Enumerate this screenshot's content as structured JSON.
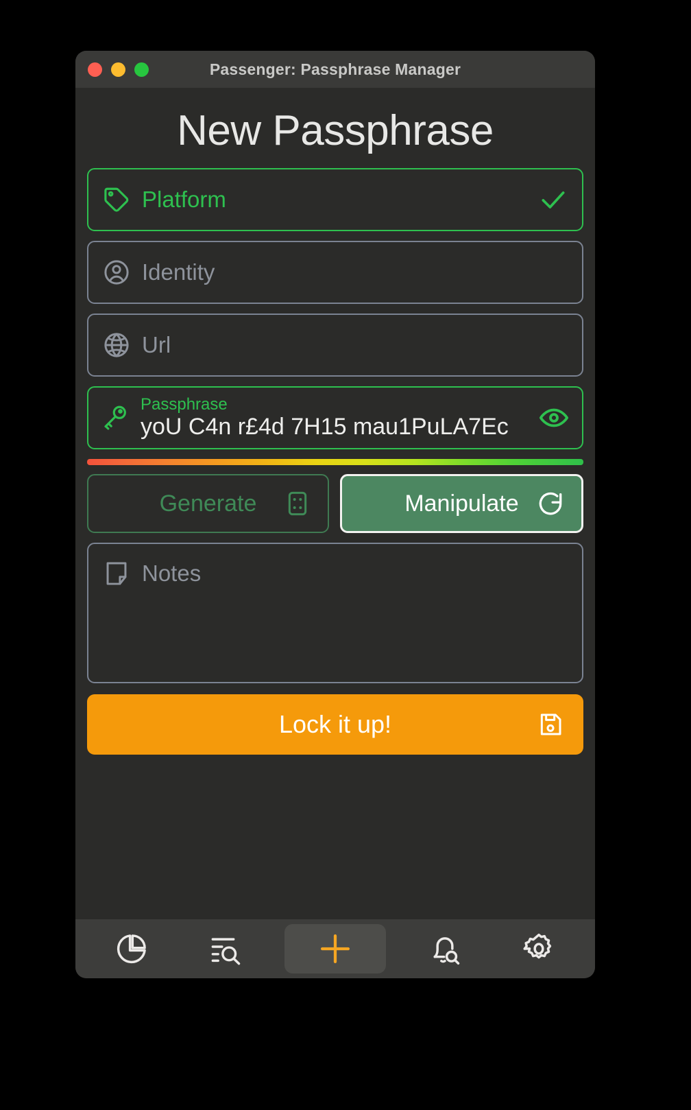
{
  "window": {
    "title": "Passenger: Passphrase Manager",
    "controls": [
      {
        "name": "close-button",
        "color": "#ff5f52"
      },
      {
        "name": "minimize-button",
        "color": "#fdbc2f"
      },
      {
        "name": "maximize-button",
        "color": "#27c63f"
      }
    ]
  },
  "page": {
    "title": "New Passphrase"
  },
  "form": {
    "platform": {
      "label": "Platform",
      "icon": "tag-icon",
      "state": "active",
      "trailing_icon": "check-icon",
      "accent": "#2ec04f"
    },
    "identity": {
      "label": "Identity",
      "icon": "user-circle-icon",
      "state": "default"
    },
    "url": {
      "label": "Url",
      "icon": "globe-icon",
      "state": "default"
    },
    "passphrase": {
      "label": "Passphrase",
      "value": "yoU C4n r£4d 7H15 mau1PuLA7Ec",
      "icon": "key-icon",
      "trailing_icon": "eye-icon",
      "state": "active",
      "accent": "#2ec04f"
    },
    "strength": {
      "name": "password-strength-meter",
      "level": "strong",
      "colors": [
        "#f4523b",
        "#f59b20",
        "#ead313",
        "#b5e41f",
        "#2fc04a"
      ]
    },
    "generate": {
      "label": "Generate",
      "icon": "dice-icon",
      "state": "secondary"
    },
    "manipulate": {
      "label": "Manipulate",
      "icon": "refresh-icon",
      "state": "primary-selected"
    },
    "notes": {
      "label": "Notes",
      "icon": "note-icon",
      "value": ""
    },
    "save": {
      "label": "Lock it up!",
      "icon": "floppy-save-icon",
      "color": "#f59a0b"
    }
  },
  "nav": {
    "items": [
      {
        "name": "nav-dashboard",
        "icon": "pie-chart-icon",
        "active": false
      },
      {
        "name": "nav-search-list",
        "icon": "list-search-icon",
        "active": false
      },
      {
        "name": "nav-add",
        "icon": "plus-icon",
        "active": true,
        "accent": "#f5a623"
      },
      {
        "name": "nav-alerts",
        "icon": "bell-search-icon",
        "active": false
      },
      {
        "name": "nav-settings",
        "icon": "gear-icon",
        "active": false
      }
    ]
  }
}
